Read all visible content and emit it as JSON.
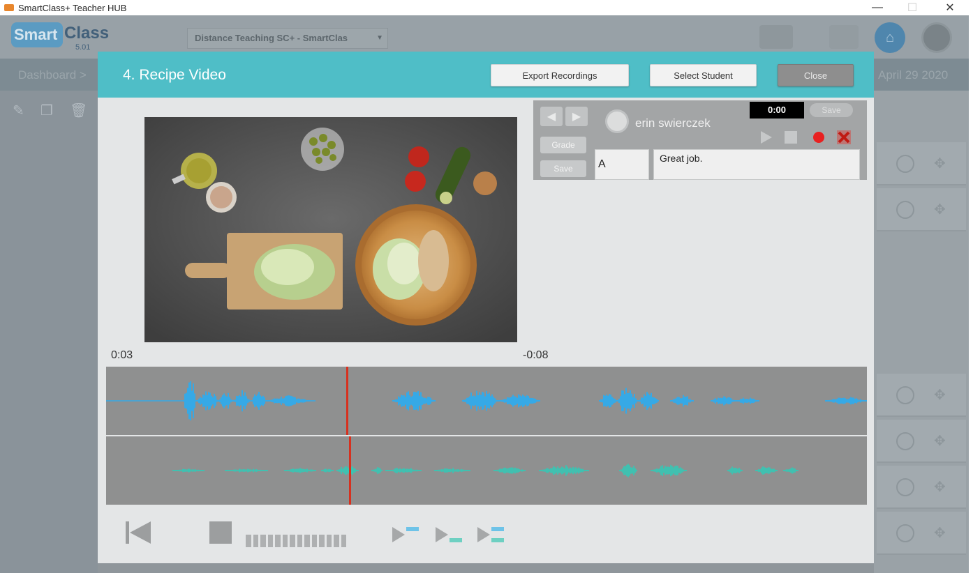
{
  "window": {
    "title": "SmartClass+ Teacher HUB",
    "minimize": "—",
    "maximize": "☐",
    "close": "✕"
  },
  "app": {
    "logo_smart": "Smart",
    "logo_class": "Class",
    "version": "5.01",
    "course_select": "Distance Teaching SC+ - SmartClas",
    "breadcrumb": "Dashboard >",
    "date": "April 29 2020"
  },
  "modal": {
    "title": "4. Recipe Video",
    "export_label": "Export Recordings",
    "select_student_label": "Select Student",
    "close_label": "Close",
    "time_current": "0:03",
    "time_remaining": "-0:08"
  },
  "grading": {
    "grade_label": "Grade",
    "save_label": "Save",
    "student_name": "erin swierczek",
    "timer": "0:00",
    "recording_save_label": "Save",
    "grade_value": "A",
    "comment_value": "Great job."
  },
  "playback": {
    "playhead_fraction": 0.316
  },
  "colors": {
    "header_teal": "#4fbec7",
    "wave_blue": "#36a9e6",
    "wave_teal": "#41c0b0",
    "playhead_red": "#d7311f",
    "record_red": "#e82020"
  }
}
